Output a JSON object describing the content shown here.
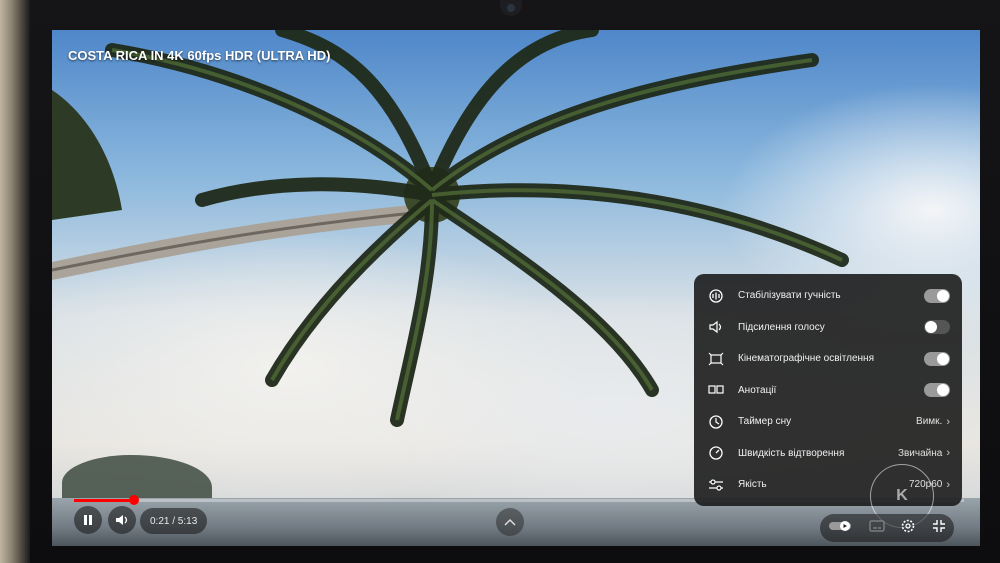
{
  "video": {
    "title": "COSTA RICA IN 4K 60fps HDR (ULTRA HD)",
    "time_display": "0:21 / 5:13",
    "progress_fraction": 0.067
  },
  "controls": {
    "play_state_icon": "pause-icon",
    "volume_icon": "volume-icon",
    "expand_icon": "chevron-up-icon",
    "autoplay_icon": "autoplay-toggle-icon",
    "subtitles_icon": "subtitles-icon",
    "settings_icon": "gear-icon",
    "fullscreen_icon": "exit-fullscreen-icon"
  },
  "settings": {
    "items": [
      {
        "label": "Стабілізувати гучність",
        "icon": "stable-volume-icon",
        "toggle": "on"
      },
      {
        "label": "Підсилення голосу",
        "icon": "voice-boost-icon",
        "toggle": "off"
      },
      {
        "label": "Кінематографічне освітлення",
        "icon": "ambient-mode-icon",
        "toggle": "on"
      },
      {
        "label": "Анотації",
        "icon": "annotations-icon",
        "toggle": "on"
      },
      {
        "label": "Таймер сну",
        "icon": "sleep-timer-icon",
        "value": "Вимк."
      },
      {
        "label": "Швидкість відтворення",
        "icon": "playback-speed-icon",
        "value": "Звичайна"
      },
      {
        "label": "Якість",
        "icon": "quality-icon",
        "value": "720p60"
      }
    ]
  },
  "watermark": {
    "text": "K"
  },
  "colors": {
    "progress": "#ff0000",
    "panel": "#1c1c1c"
  }
}
